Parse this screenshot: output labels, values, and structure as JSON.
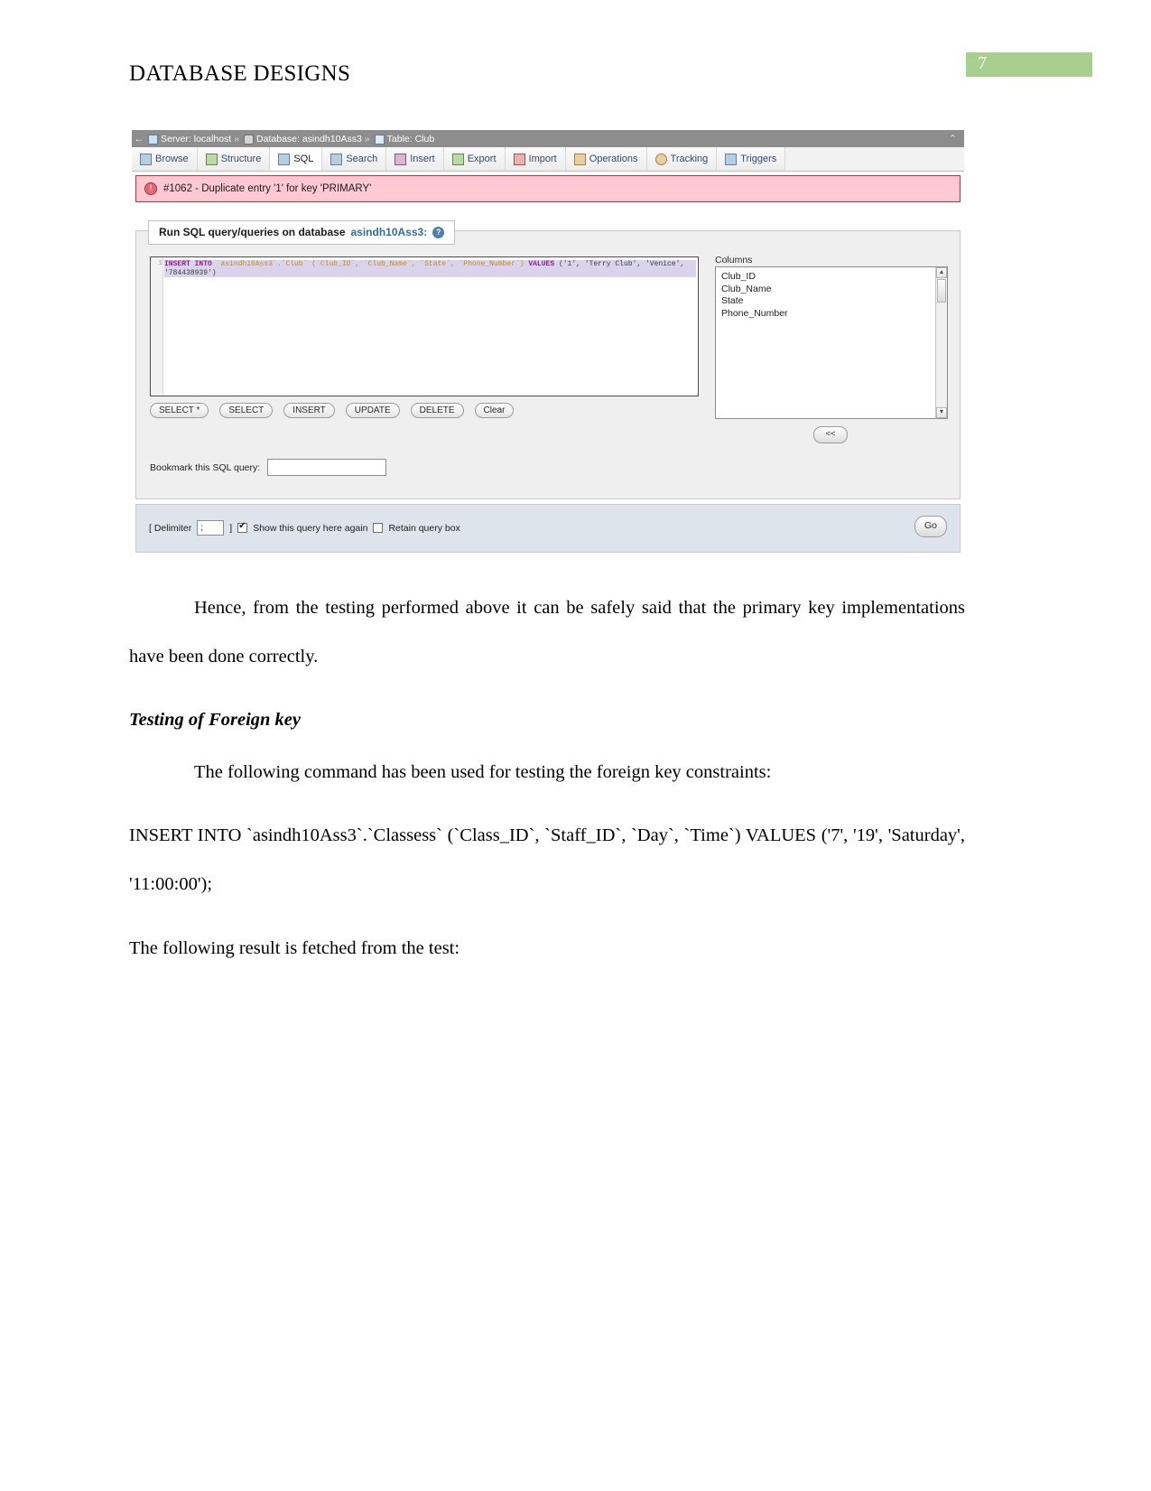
{
  "document": {
    "header_title": "DATABASE DESIGNS",
    "page_number": "7"
  },
  "screenshot": {
    "breadcrumb": {
      "back_arrow": "←",
      "server": "Server: localhost",
      "sep1": "»",
      "database": "Database: asindh10Ass3",
      "sep2": "»",
      "table": "Table: Club",
      "collapse": "⌃"
    },
    "tabs": [
      {
        "label": "Browse",
        "icon": "browse-icon"
      },
      {
        "label": "Structure",
        "icon": "structure-icon"
      },
      {
        "label": "SQL",
        "icon": "sql-icon"
      },
      {
        "label": "Search",
        "icon": "search-icon"
      },
      {
        "label": "Insert",
        "icon": "insert-icon"
      },
      {
        "label": "Export",
        "icon": "export-icon"
      },
      {
        "label": "Import",
        "icon": "import-icon"
      },
      {
        "label": "Operations",
        "icon": "wrench-icon"
      },
      {
        "label": "Tracking",
        "icon": "tracking-icon"
      },
      {
        "label": "Triggers",
        "icon": "triggers-icon"
      }
    ],
    "error": {
      "icon": "error-icon",
      "text": "#1062 - Duplicate entry '1' for key 'PRIMARY'"
    },
    "panel": {
      "legend_prefix": "Run SQL query/queries on database",
      "legend_db": "asindh10Ass3:",
      "help_icon": "?",
      "editor": {
        "line_number": "1",
        "sql_keyword1": "INSERT INTO",
        "sql_target": "`asindh10Ass3`.`Club`",
        "sql_columns": "(`Club_ID`, `Club_Name`, `State`, `Phone_Number`)",
        "sql_keyword2": "VALUES",
        "sql_values": "('1', 'Terry Club', 'Venice', '784438939')"
      },
      "buttons": [
        "SELECT *",
        "SELECT",
        "INSERT",
        "UPDATE",
        "DELETE",
        "Clear"
      ],
      "columns_label": "Columns",
      "columns": [
        "Club_ID",
        "Club_Name",
        "State",
        "Phone_Number"
      ],
      "move_left_button": "<<",
      "bookmark_label": "Bookmark this SQL query:",
      "bookmark_value": ""
    },
    "footer": {
      "delimiter_open": "[ Delimiter",
      "delimiter_value": ";",
      "delimiter_close": "]",
      "show_query_again": "Show this query here again",
      "retain_query_box": "Retain query box",
      "go_button": "Go"
    }
  },
  "body": {
    "paragraph1": "Hence, from the testing performed above it can be safely said that the primary key implementations have been done correctly.",
    "heading1": "Testing of Foreign key",
    "paragraph2": "The following command has been used for testing the foreign key constraints:",
    "paragraph3": "INSERT INTO `asindh10Ass3`.`Classess` (`Class_ID`, `Staff_ID`, `Day`, `Time`) VALUES ('7', '19', 'Saturday', '11:00:00');",
    "paragraph4": "The following result is fetched from the test:"
  }
}
